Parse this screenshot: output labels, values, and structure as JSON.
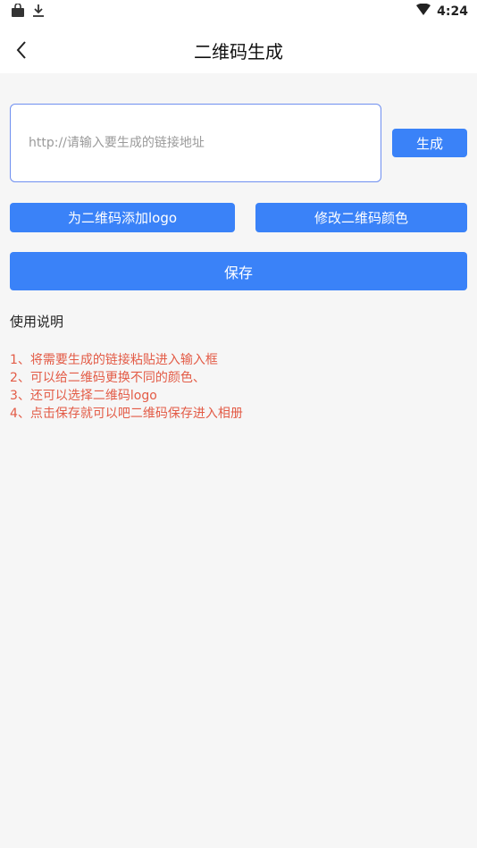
{
  "status_bar": {
    "time": "4:24",
    "icons": [
      "shopping-bag-icon",
      "download-icon",
      "wifi-icon"
    ]
  },
  "header": {
    "title": "二维码生成",
    "back_icon": "back-arrow-icon"
  },
  "form": {
    "url_placeholder": "http://请输入要生成的链接地址",
    "url_value": ""
  },
  "buttons": {
    "generate": "生成",
    "add_logo": "为二维码添加logo",
    "change_color": "修改二维码颜色",
    "save": "保存"
  },
  "instructions": {
    "title": "使用说明",
    "items": [
      "1、将需要生成的链接粘贴进入输入框",
      "2、可以给二维码更换不同的颜色、",
      "3、还可以选择二维码logo",
      "4、点击保存就可以吧二维码保存进入相册"
    ]
  },
  "colors": {
    "accent": "#3a82f8",
    "input_border": "#6f8ff0",
    "instruction_text": "#e35b46",
    "background": "#f6f6f6"
  }
}
